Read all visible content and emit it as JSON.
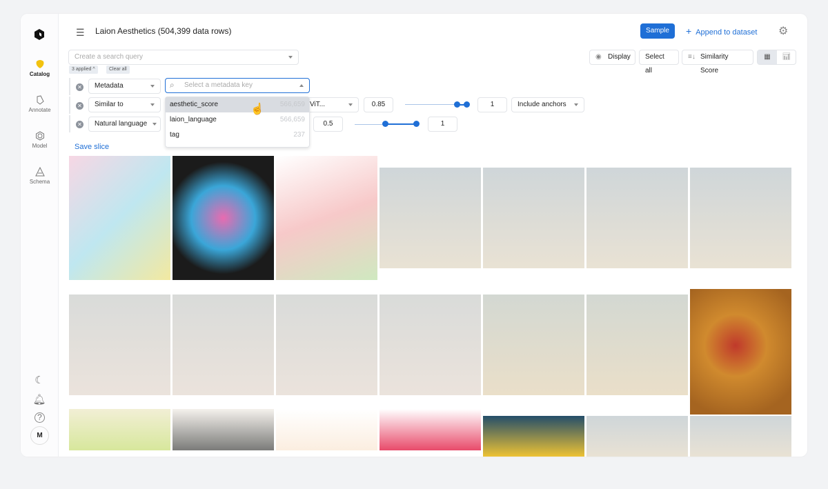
{
  "sidebar": {
    "items": [
      {
        "label": "Catalog",
        "icon": "catalog-icon",
        "active": true
      },
      {
        "label": "Annotate",
        "icon": "annotate-icon"
      },
      {
        "label": "Model",
        "icon": "model-icon"
      },
      {
        "label": "Schema",
        "icon": "schema-icon"
      }
    ],
    "bottom": {
      "theme": "moon-icon",
      "notifications": "bell-icon",
      "help": "?",
      "avatar": "M"
    }
  },
  "header": {
    "title": "Laion Aesthetics (504,399 data rows)",
    "sample": "Sample",
    "append": "Append to dataset",
    "accent": "#1f6fd6"
  },
  "search": {
    "placeholder": "Create a search query",
    "applied": "3 applied",
    "clear": "Clear all"
  },
  "toolbar": {
    "display": "Display",
    "select_all": "Select all",
    "sort": "Similarity Score"
  },
  "filters": [
    {
      "type": "Metadata",
      "key_placeholder": "Select a metadata key"
    },
    {
      "type": "Similar to",
      "model": "ViT...",
      "min": "0.85",
      "max": "1",
      "anchors": "Include anchors",
      "range": [
        0.85,
        1
      ]
    },
    {
      "type": "Natural language",
      "min": "0.5",
      "max": "1",
      "range": [
        0.5,
        1
      ]
    }
  ],
  "dropdown": {
    "options": [
      {
        "key": "aesthetic_score",
        "count": "566,659"
      },
      {
        "key": "laion_language",
        "count": "566,659"
      },
      {
        "key": "tag",
        "count": "237"
      }
    ]
  },
  "save_slice": "Save slice",
  "grid": {
    "rows": 3,
    "cols": 7
  }
}
